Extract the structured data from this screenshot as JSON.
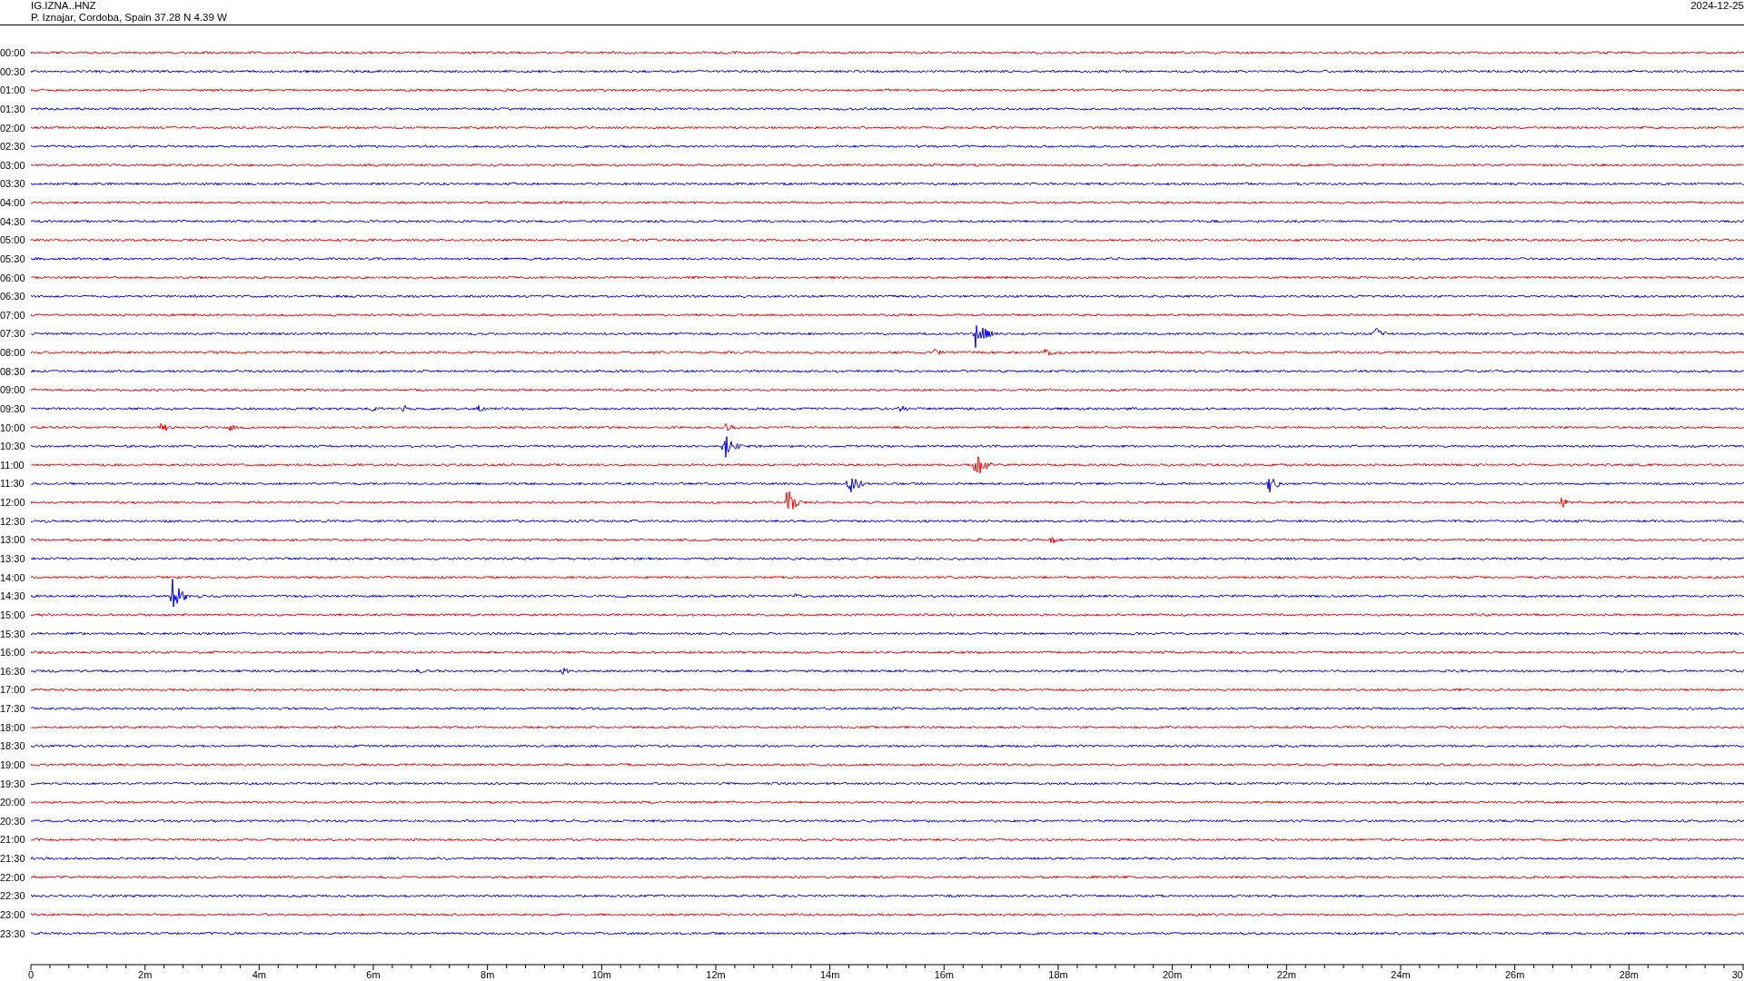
{
  "header": {
    "station": "IG.IZNA..HNZ",
    "location": "P. Iznajar, Cordoba, Spain  37.28 N 4.39 W",
    "date": "2024-12-25"
  },
  "rows": [
    {
      "label": "00:00",
      "color": "#ff0000"
    },
    {
      "label": "00:30",
      "color": "#0000ff"
    },
    {
      "label": "01:00",
      "color": "#ff0000"
    },
    {
      "label": "01:30",
      "color": "#0000ff"
    },
    {
      "label": "02:00",
      "color": "#ff0000"
    },
    {
      "label": "02:30",
      "color": "#0000ff"
    },
    {
      "label": "03:00",
      "color": "#ff0000"
    },
    {
      "label": "03:30",
      "color": "#0000ff"
    },
    {
      "label": "04:00",
      "color": "#ff0000"
    },
    {
      "label": "04:30",
      "color": "#0000ff"
    },
    {
      "label": "05:00",
      "color": "#ff0000"
    },
    {
      "label": "05:30",
      "color": "#0000ff"
    },
    {
      "label": "06:00",
      "color": "#ff0000"
    },
    {
      "label": "06:30",
      "color": "#0000ff"
    },
    {
      "label": "07:00",
      "color": "#ff0000"
    },
    {
      "label": "07:30",
      "color": "#0000ff"
    },
    {
      "label": "08:00",
      "color": "#ff0000"
    },
    {
      "label": "08:30",
      "color": "#0000ff"
    },
    {
      "label": "09:00",
      "color": "#ff0000"
    },
    {
      "label": "09:30",
      "color": "#0000ff"
    },
    {
      "label": "10:00",
      "color": "#ff0000"
    },
    {
      "label": "10:30",
      "color": "#0000ff"
    },
    {
      "label": "11:00",
      "color": "#ff0000"
    },
    {
      "label": "11:30",
      "color": "#0000ff"
    },
    {
      "label": "12:00",
      "color": "#ff0000"
    },
    {
      "label": "12:30",
      "color": "#0000ff"
    },
    {
      "label": "13:00",
      "color": "#ff0000"
    },
    {
      "label": "13:30",
      "color": "#0000ff"
    },
    {
      "label": "14:00",
      "color": "#ff0000"
    },
    {
      "label": "14:30",
      "color": "#0000ff"
    },
    {
      "label": "15:00",
      "color": "#ff0000"
    },
    {
      "label": "15:30",
      "color": "#0000ff"
    },
    {
      "label": "16:00",
      "color": "#ff0000"
    },
    {
      "label": "16:30",
      "color": "#0000ff"
    },
    {
      "label": "17:00",
      "color": "#ff0000"
    },
    {
      "label": "17:30",
      "color": "#0000ff"
    },
    {
      "label": "18:00",
      "color": "#ff0000"
    },
    {
      "label": "18:30",
      "color": "#0000ff"
    },
    {
      "label": "19:00",
      "color": "#ff0000"
    },
    {
      "label": "19:30",
      "color": "#0000ff"
    },
    {
      "label": "20:00",
      "color": "#ff0000"
    },
    {
      "label": "20:30",
      "color": "#0000ff"
    },
    {
      "label": "21:00",
      "color": "#ff0000"
    },
    {
      "label": "21:30",
      "color": "#0000ff"
    },
    {
      "label": "22:00",
      "color": "#ff0000"
    },
    {
      "label": "22:30",
      "color": "#0000ff"
    },
    {
      "label": "23:00",
      "color": "#ff0000"
    },
    {
      "label": "23:30",
      "color": "#0000ff"
    }
  ],
  "x_axis": {
    "labels": [
      "0",
      "2m",
      "4m",
      "6m",
      "8m",
      "10m",
      "12m",
      "14m",
      "16m",
      "18m",
      "20m",
      "22m",
      "24m",
      "26m",
      "28m",
      "30"
    ]
  }
}
